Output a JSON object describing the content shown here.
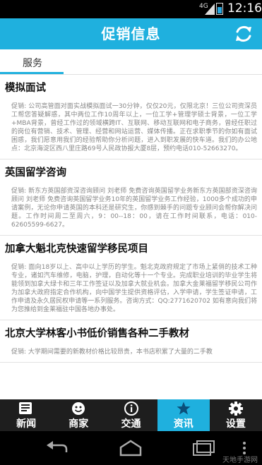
{
  "status": {
    "network": "4G",
    "time": "12:16"
  },
  "header": {
    "title": "促销信息"
  },
  "tabs": [
    {
      "label": "服务"
    }
  ],
  "items": [
    {
      "title": "模拟面试",
      "body": "促销: 公司高管面对面实战模拟面试一30分钟，仅仅20元，仅限北京！三位公司资深员工帮您答疑解惑，其中两位工作10周年以上，一位工学+管理学硕士背景，一位工学+MBA背景，曾经工作过的领域横跨IT、互联网、移动互联网和电子商务，曾经任职过的岗位有营销、技术、管理、经营和网站运营、媒体传播。正在求职季节的你如有面试困惑，我们愿意用我们的经验帮助你分析问题，进入到职发展的快车道。我们的办公地点：北京海淀区西八里庄路69号人民政协报大厦8层，预约电话010-52663270。"
    },
    {
      "title": "英国留学咨询",
      "body": "促销: 新东方英国部资深咨询顾问 刘老师 免费咨询英国留学业务新东方英国部资深咨询顾问 刘老师 免费咨询英国留学业务10年的英国留学业务工作经验，1000多个成功的申请案例，无论你申请英国的本科还是研究生，你感到棘手的问题专业顾问会帮你解决问题。工作时间周二至周六，9：00--18：00，请在工作时间联系，电话：010-62605599-6627。"
    },
    {
      "title": "加拿大魁北克快速留学移民项目",
      "body": "促销: 面向18岁以上、高中以上学历的学生。魁北克政府规定了市场上紧俏的技术工种专业，诸如汽车维修，电脑，护理，自动化等十一个专业。完成职业培训的毕业学生将能领到加拿大绿卡和三年工作签证以及加拿大就业机会。加拿大金莱福留学移民公司作为加拿大政府指定合作机构，向中国学生提供资格评估，入学申请，学生签证申请，工作申请及永久居民权申请等一系列服务。咨询方式：QQ:2771620702 如有意向我们将为您推给到金莱福驻中国各地办事处。"
    },
    {
      "title": "北京大学林客小书低价销售各种二手教材",
      "body": "促销: 大学期间需要的新教材价格比较昂贵，本书店积累了大量的二手教"
    }
  ],
  "bottom_nav": [
    {
      "label": "新闻",
      "icon": "newspaper-icon"
    },
    {
      "label": "商家",
      "icon": "smiley-icon"
    },
    {
      "label": "交通",
      "icon": "info-icon"
    },
    {
      "label": "资讯",
      "icon": "star-icon"
    },
    {
      "label": "设置",
      "icon": "gear-icon"
    }
  ],
  "active_nav": "资讯",
  "watermark": "天地手游网",
  "colors": {
    "accent": "#1fb0de",
    "nav_background": "#1e1e1e"
  }
}
